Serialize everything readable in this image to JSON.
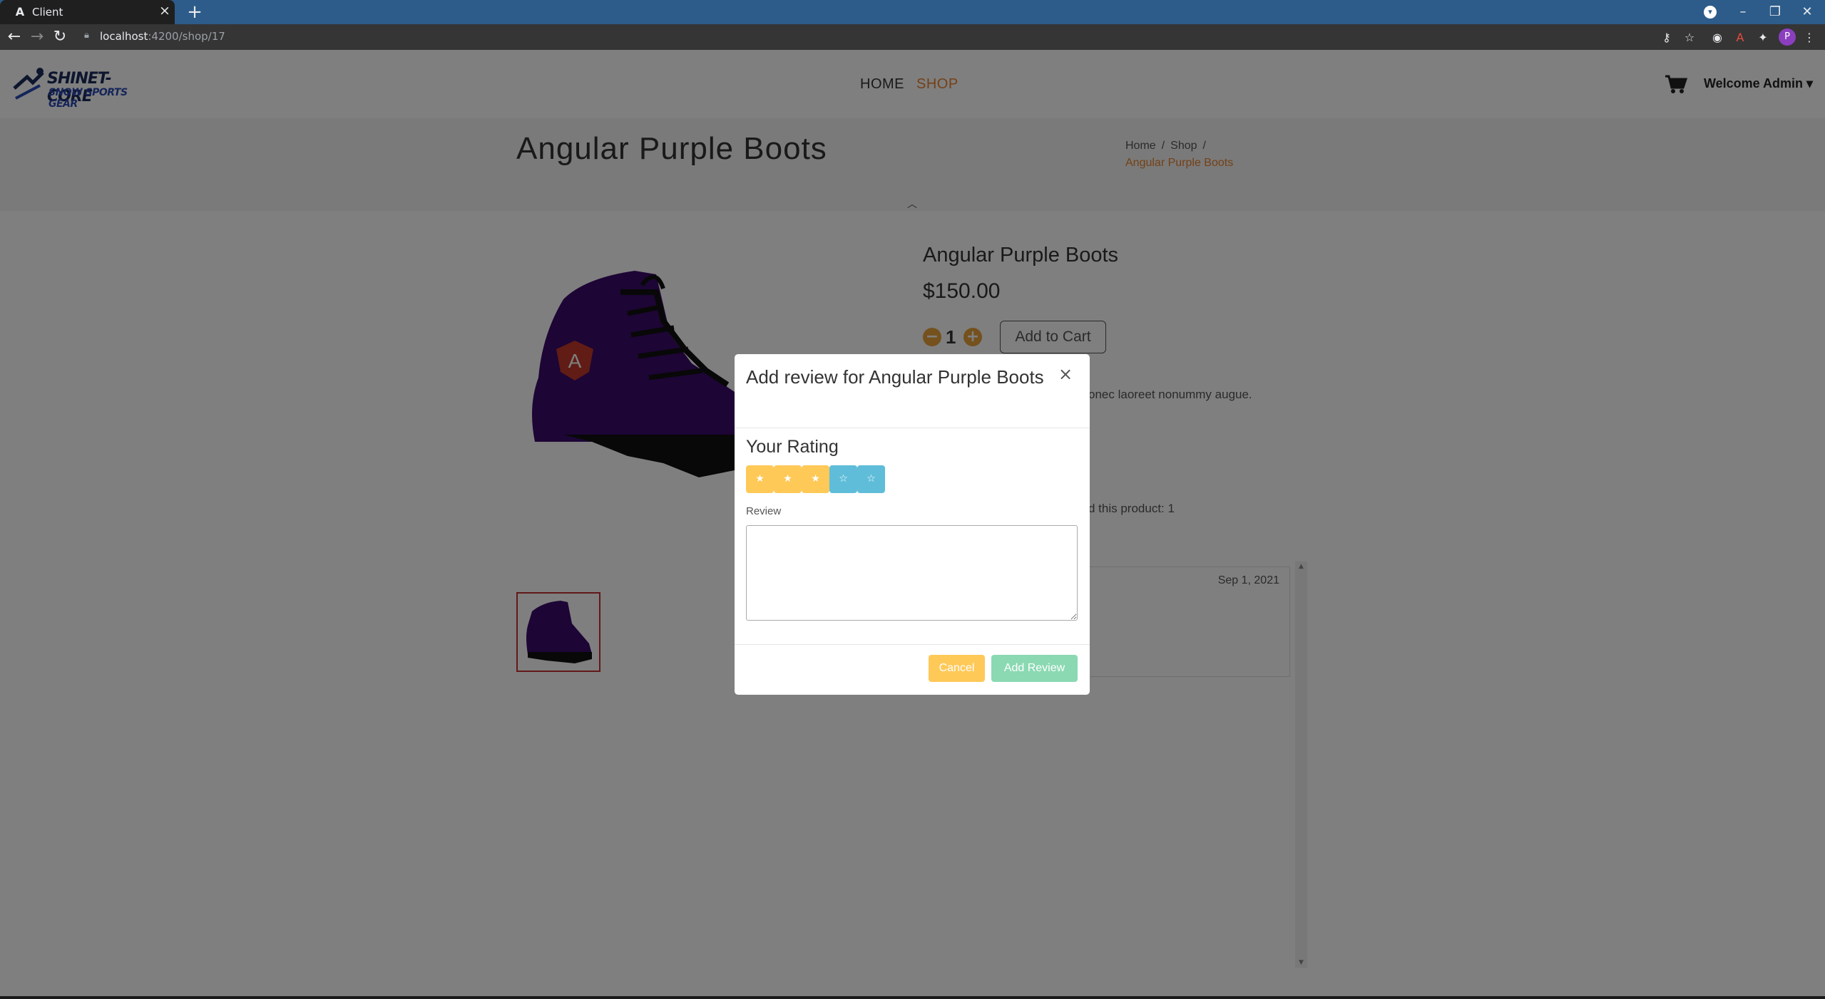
{
  "browser": {
    "tab_favicon": "A",
    "tab_title": "Client",
    "tab_close": "×",
    "new_tab": "+",
    "url_host": "localhost",
    "url_path": ":4200/shop/17",
    "profile_initial": "P",
    "window_controls": [
      "–",
      "❐",
      "✕"
    ]
  },
  "site": {
    "logo_line1": "SHINET-CORE",
    "logo_line2": "SNOW SPORTS GEAR",
    "nav": {
      "home": "HOME",
      "shop": "SHOP"
    },
    "welcome": "Welcome Admin",
    "accent_color": "#e9822c"
  },
  "banner": {
    "title": "Angular Purple Boots",
    "breadcrumb": [
      "Home",
      "Shop"
    ],
    "breadcrumb_separator": "/",
    "breadcrumb_active": "Angular Purple Boots"
  },
  "product": {
    "name": "Angular Purple Boots",
    "price": "$150.00",
    "quantity": "1",
    "add_to_cart": "Add to Cart",
    "description_fragment": "onec laoreet nonummy augue.",
    "purchased_fragment": "d this product: 1",
    "review_date": "Sep 1, 2021"
  },
  "modal": {
    "title": "Add review for Angular Purple Boots",
    "close": "×",
    "rating_heading": "Your Rating",
    "rating_value": 3,
    "rating_max": 5,
    "star_glyph": "★",
    "star_colors": {
      "on": "#ffc958",
      "off": "#5fbdd9"
    },
    "review_label": "Review",
    "review_value": "",
    "cancel_label": "Cancel",
    "submit_label": "Add Review"
  }
}
